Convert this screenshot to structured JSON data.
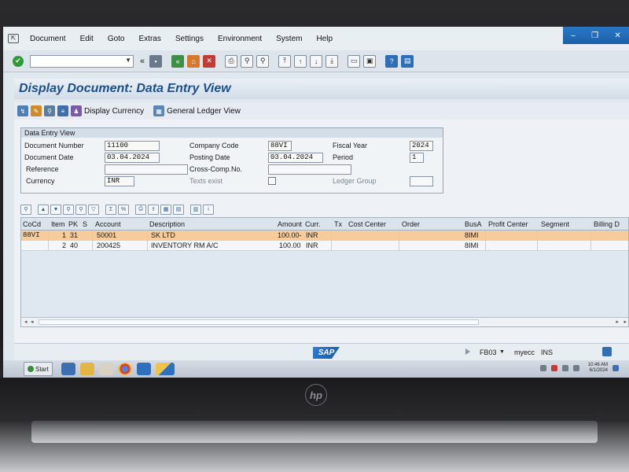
{
  "menubar": {
    "items": [
      "Document",
      "Edit",
      "Goto",
      "Extras",
      "Settings",
      "Environment",
      "System",
      "Help"
    ]
  },
  "page": {
    "title": "Display Document: Data Entry View"
  },
  "app_toolbar": {
    "display_currency": "Display Currency",
    "general_ledger_view": "General Ledger View"
  },
  "header": {
    "group_title": "Data Entry View",
    "document_number_label": "Document Number",
    "document_number": "11100",
    "company_code_label": "Company Code",
    "company_code": "88VI",
    "fiscal_year_label": "Fiscal Year",
    "fiscal_year": "2024",
    "document_date_label": "Document Date",
    "document_date": "03.04.2024",
    "posting_date_label": "Posting Date",
    "posting_date": "03.04.2024",
    "period_label": "Period",
    "period": "1",
    "reference_label": "Reference",
    "reference": "",
    "cross_comp_label": "Cross-Comp.No.",
    "cross_comp": "",
    "currency_label": "Currency",
    "currency": "INR",
    "texts_exist_label": "Texts exist",
    "ledger_group_label": "Ledger Group",
    "ledger_group": ""
  },
  "grid": {
    "columns": [
      "CoCd",
      "Item",
      "PK",
      "S",
      "Account",
      "Description",
      "Amount",
      "Curr.",
      "Tx",
      "Cost Center",
      "Order",
      "BusA",
      "Profit Center",
      "Segment",
      "Billing D"
    ],
    "rows": [
      {
        "cocd": "88VI",
        "item": "1",
        "pk": "31",
        "s": "",
        "account": "50001",
        "description": "SK LTD",
        "amount": "100.00-",
        "curr": "INR",
        "tx": "",
        "cost_center": "",
        "order": "",
        "busa": "8IMI",
        "profit_center": "",
        "segment": "",
        "billing": ""
      },
      {
        "cocd": "",
        "item": "2",
        "pk": "40",
        "s": "",
        "account": "200425",
        "description": "INVENTORY RM A/C",
        "amount": "100.00",
        "curr": "INR",
        "tx": "",
        "cost_center": "",
        "order": "",
        "busa": "8IMI",
        "profit_center": "",
        "segment": "",
        "billing": ""
      }
    ]
  },
  "status": {
    "logo": "SAP",
    "transaction": "FB03",
    "system": "myecc",
    "mode": "INS"
  },
  "taskbar": {
    "start": "Start",
    "time": "10:46 AM",
    "date": "6/1/2024"
  }
}
